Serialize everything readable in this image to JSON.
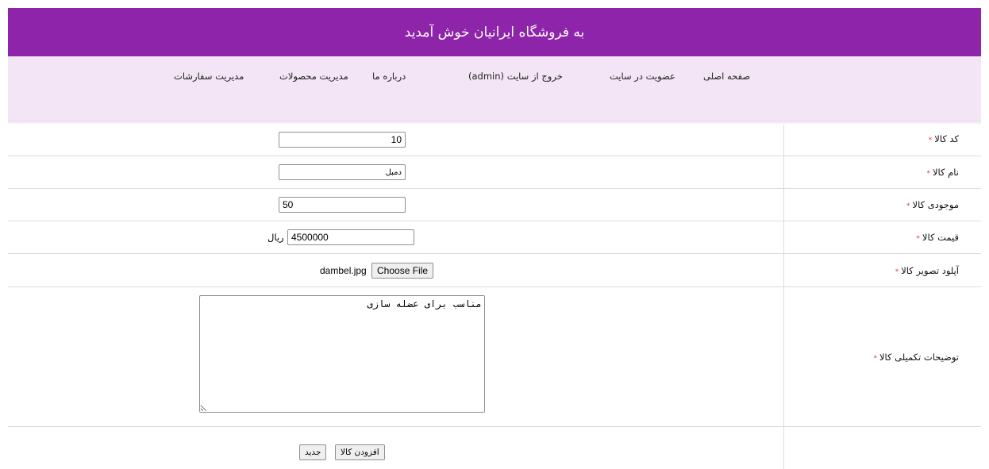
{
  "header": {
    "title": "به فروشگاه ایرانیان خوش آمدید",
    "bg_color": "#8e24aa"
  },
  "nav": {
    "bg_color": "#f3e5f5",
    "items": [
      {
        "label": "صفحه اصلی"
      },
      {
        "label": "عضویت در سایت"
      },
      {
        "label": "خروج از سایت (admin)"
      },
      {
        "label": "درباره ما"
      },
      {
        "label": "مدیریت محصولات"
      },
      {
        "label": "مدیریت سفارشات"
      }
    ]
  },
  "form": {
    "required_mark": "*",
    "product_code": {
      "label": "کد کالا",
      "value": "10"
    },
    "product_name": {
      "label": "نام کالا",
      "value": "دمبل"
    },
    "stock": {
      "label": "موجودی کالا",
      "value": "50"
    },
    "price": {
      "label": "قیمت کالا",
      "value": "4500000",
      "unit": "ریال"
    },
    "image": {
      "label": "آپلود تصویر کالا",
      "button": "Choose File",
      "filename": "dambel.jpg"
    },
    "description": {
      "label": "توضیحات تکمیلی کالا",
      "value": "مناسب برای عضله سازی"
    },
    "add_button": "افزودن کالا",
    "new_button": "جدید"
  }
}
